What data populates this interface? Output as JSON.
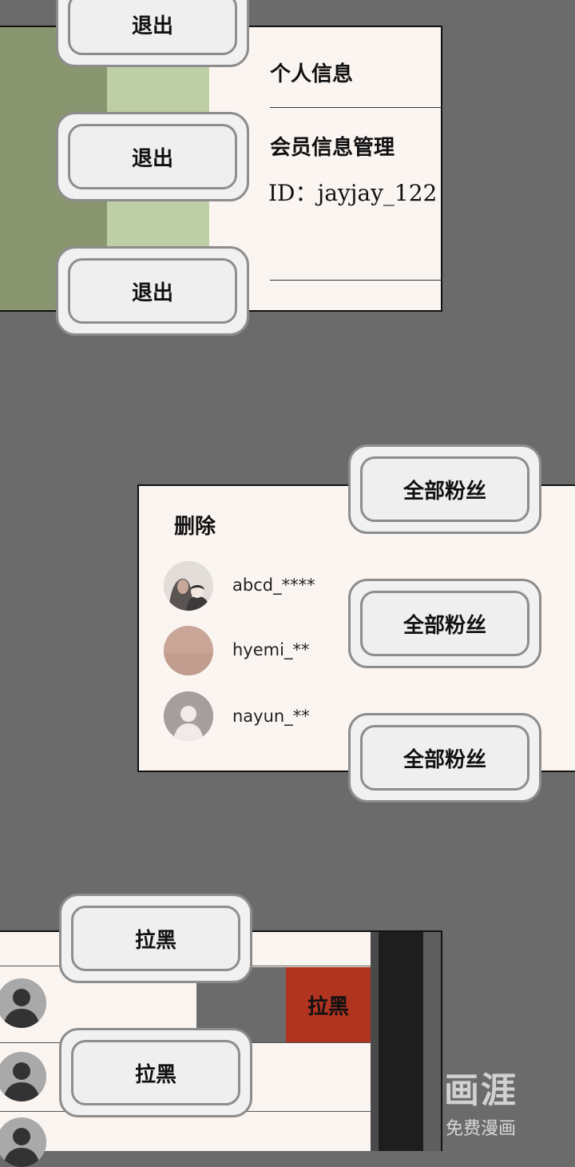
{
  "panel1": {
    "title": "个人信息",
    "subtitle": "会员信息管理",
    "id_text": "ID：jayjay_122",
    "buttons": [
      "退出",
      "退出",
      "退出"
    ]
  },
  "panel2": {
    "delete_label": "删除",
    "followers": [
      {
        "name": "abcd_****"
      },
      {
        "name": "hyemi_**"
      },
      {
        "name": "nayun_**"
      }
    ],
    "buttons": [
      "全部粉丝",
      "全部粉丝",
      "全部粉丝"
    ]
  },
  "panel3": {
    "buttons": [
      "拉黑",
      "拉黑"
    ],
    "swipe_action": "拉黑"
  },
  "watermark": {
    "logo": "画涯",
    "sub": "免费漫画"
  }
}
